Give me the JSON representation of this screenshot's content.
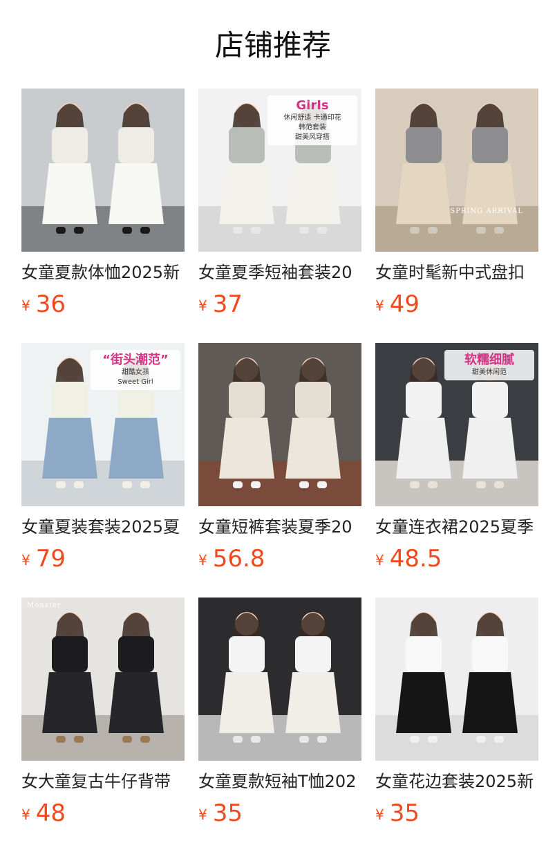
{
  "header": {
    "title": "店铺推荐"
  },
  "colors": {
    "price": "#f04a1c",
    "title": "#111111",
    "name": "#222222"
  },
  "products": [
    {
      "name": "女童夏款体恤2025新",
      "currency": "¥",
      "price": "36",
      "image": "photo-two-girls-white-tee-white-lace-skirt",
      "palette": {
        "bg": "#c9ccce",
        "floor": "#7f8386",
        "top": "#efece6",
        "bottom": "#f7f7f4",
        "shoe": "#1a1a1a"
      }
    },
    {
      "name": "女童夏季短袖套装20",
      "currency": "¥",
      "price": "37",
      "image": "photo-girls-grey-tee-white-skirt-banner",
      "palette": {
        "bg": "#f2f2f2",
        "floor": "#d9d9d9",
        "top": "#b8bdb8",
        "bottom": "#f4f2ec",
        "shoe": "#e8e8e8"
      },
      "banner": {
        "title": "GirIs",
        "line1": "休闲舒适 卡通印花",
        "tag1": "韩范套装",
        "tag2": "甜美风穿搭"
      }
    },
    {
      "name": "女童时髦新中式盘扣",
      "currency": "¥",
      "price": "49",
      "image": "photo-two-girls-grey-and-beige-sets",
      "palette": {
        "bg": "#d8cdbd",
        "floor": "#b9aa95",
        "top": "#8e8e90",
        "bottom": "#e4d6c0",
        "shoe": "#cfc8bd"
      },
      "overlay": "SPRING ARRIVAL"
    },
    {
      "name": "女童夏装套装2025夏",
      "currency": "¥",
      "price": "79",
      "image": "photo-girls-white-top-denim-pants-banner",
      "palette": {
        "bg": "#eef2f3",
        "floor": "#cfd5d8",
        "top": "#f1f0e4",
        "bottom": "#8ea9c6",
        "shoe": "#f3efe6"
      },
      "banner": {
        "title": "“街头潮范”",
        "line1": "甜酷女孩",
        "line2": "Sweet Girl"
      }
    },
    {
      "name": "女童短裤套装夏季20",
      "currency": "¥",
      "price": "56.8",
      "image": "photo-two-girls-beige-tee-shorts-caps",
      "palette": {
        "bg": "#5f5a55",
        "floor": "#7a4b3a",
        "top": "#e4ddd2",
        "bottom": "#ece6dc",
        "shoe": "#f2f2f2"
      }
    },
    {
      "name": "女童连衣裙2025夏季",
      "currency": "¥",
      "price": "48.5",
      "image": "photo-girls-white-black-pink-dresses-banner",
      "palette": {
        "bg": "#3a3d42",
        "floor": "#c8c4c0",
        "top": "#f2f2f2",
        "bottom": "#f0f0f0",
        "shoe": "#e9e2d8"
      },
      "banner": {
        "title": "软糯细腻",
        "line1": "甜美休闲范"
      }
    },
    {
      "name": "女大童复古牛仔背带",
      "currency": "¥",
      "price": "48",
      "image": "photo-two-girls-black-pinafore-dresses",
      "palette": {
        "bg": "#e6e4e1",
        "floor": "#b7b2ab",
        "top": "#1c1c1e",
        "bottom": "#26262a",
        "shoe": "#9a7a55"
      },
      "overlay": "Monster"
    },
    {
      "name": "女童夏款短袖T恤202",
      "currency": "¥",
      "price": "35",
      "image": "photo-girls-white-tee-white-skirt-sofa",
      "palette": {
        "bg": "#2c2c2e",
        "floor": "#b8b8b8",
        "top": "#f4f4f4",
        "bottom": "#f1eee8",
        "shoe": "#e8e8e8"
      }
    },
    {
      "name": "女童花边套装2025新",
      "currency": "¥",
      "price": "35",
      "image": "photo-two-girls-white-tee-black-cargo-pants",
      "palette": {
        "bg": "#eeeeee",
        "floor": "#dcdcdc",
        "top": "#f8f8f8",
        "bottom": "#151515",
        "shoe": "#f0f0f0"
      }
    }
  ]
}
